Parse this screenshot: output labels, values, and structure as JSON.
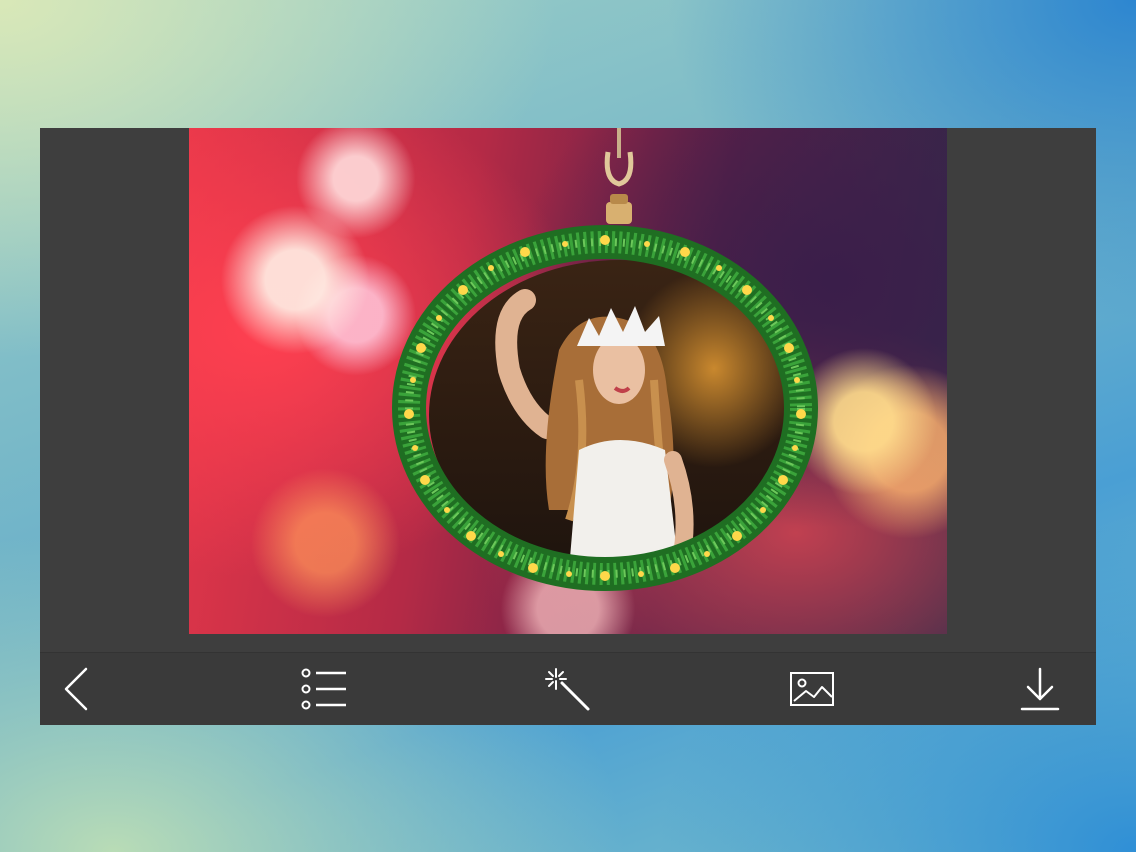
{
  "toolbar": {
    "buttons": [
      {
        "icon": "back-icon"
      },
      {
        "icon": "list-icon"
      },
      {
        "icon": "magic-wand-icon"
      },
      {
        "icon": "image-icon"
      },
      {
        "icon": "download-icon"
      }
    ]
  },
  "colors": {
    "toolbar_bg": "#3a3a3a",
    "canvas_bg": "#3e3e3e",
    "icon": "#ffffff",
    "wreath": "#2f8a2a",
    "star": "#ffd84a"
  }
}
